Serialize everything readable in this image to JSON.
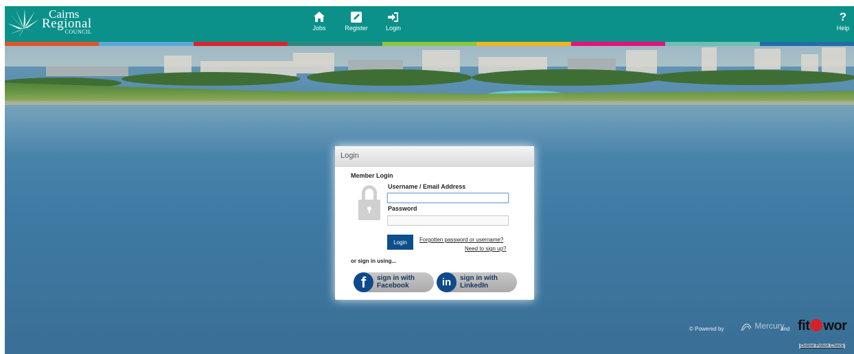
{
  "header": {
    "logo": {
      "line1": "Cairns",
      "line2": "Regional",
      "line3": "COUNCIL"
    },
    "nav": [
      {
        "label": "Jobs",
        "icon": "home-icon"
      },
      {
        "label": "Register",
        "icon": "edit-icon"
      },
      {
        "label": "Login",
        "icon": "login-icon"
      }
    ],
    "help": {
      "glyph": "?",
      "label": "Help"
    },
    "colors": {
      "bar": "#0b918a"
    },
    "stripe_colors": [
      "#e4542a",
      "#5aa8d8",
      "#d9232e",
      "#2a8a7c",
      "#8cc63e",
      "#f4b320",
      "#e6127e",
      "#6dc1b4",
      "#1f6ea8"
    ]
  },
  "login": {
    "title": "Login",
    "member_login": "Member Login",
    "username_label": "Username / Email Address",
    "username_value": "",
    "password_label": "Password",
    "password_value": "",
    "login_button": "Login",
    "forgot_link": "Forgotten password or username?",
    "signup_link": "Need to sign up?",
    "or_sign_in": "or sign in using...",
    "facebook": {
      "line1": "sign in with",
      "line2": "Facebook",
      "glyph": "f"
    },
    "linkedin": {
      "line1": "sign in with",
      "line2": "LinkedIn",
      "glyph": "in"
    }
  },
  "footer": {
    "powered_by": "© Powered by",
    "mercury": "Mercury",
    "and": "and",
    "fit_prefix": "fit",
    "fit_suffix": "wor",
    "online_police_check": "Online Police Check"
  }
}
